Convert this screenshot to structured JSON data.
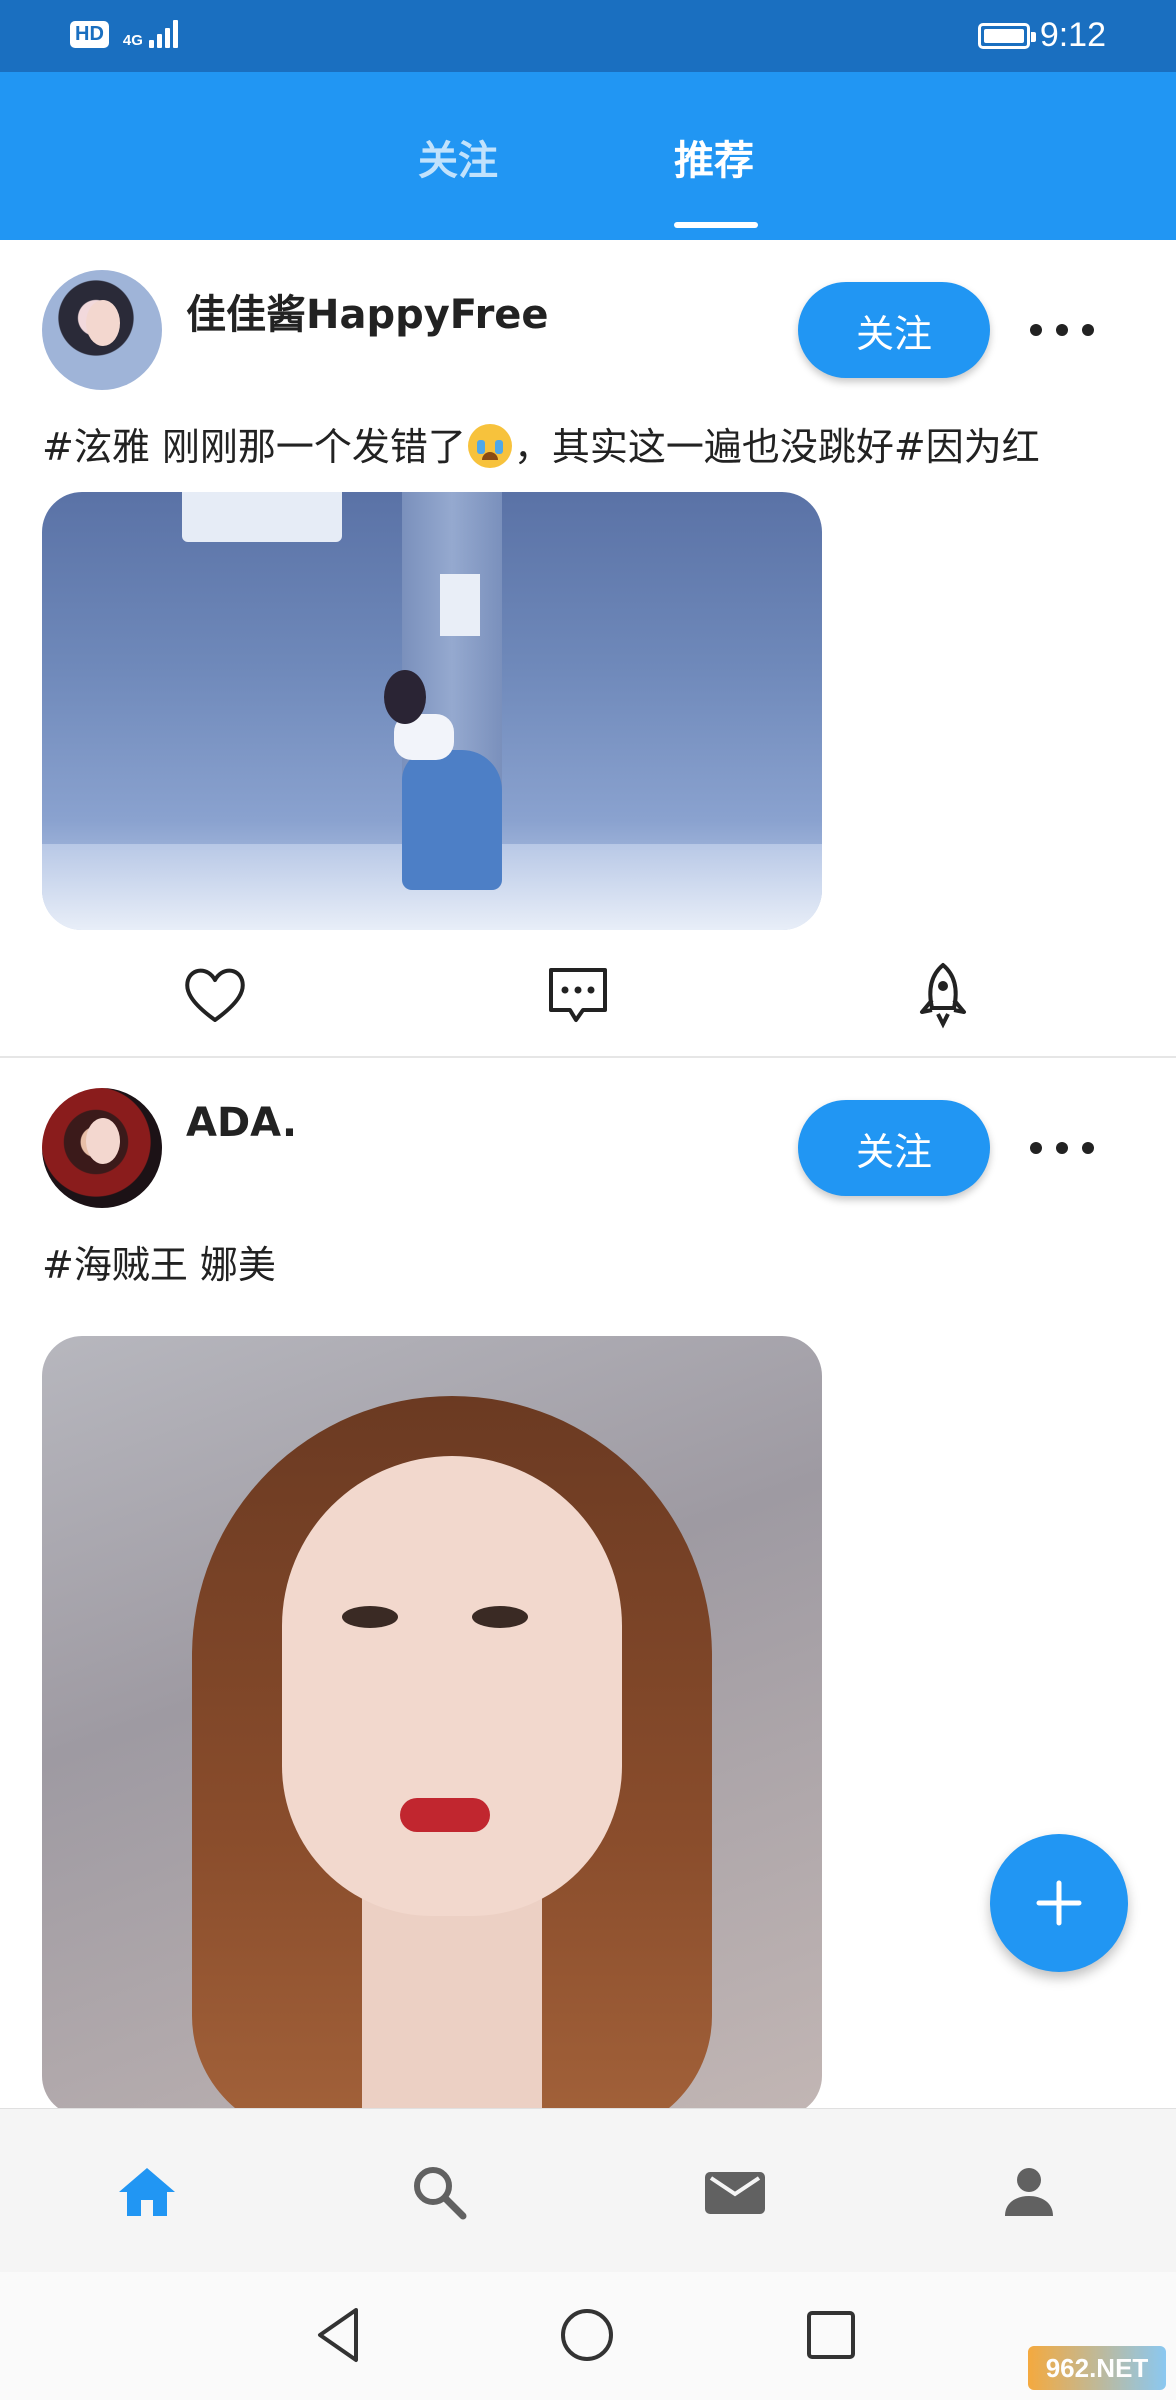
{
  "status_bar": {
    "hd_label": "HD",
    "network_label": "4G",
    "signal_level": 4,
    "battery_level": 1.0,
    "time": "9:12"
  },
  "tabs": [
    {
      "label": "关注",
      "active": false
    },
    {
      "label": "推荐",
      "active": true
    }
  ],
  "posts": [
    {
      "username": "佳佳酱HappyFree",
      "follow_label": "关注",
      "caption_before_emoji": "#泫雅 刚刚那一个发错了",
      "caption_emoji": "loudly-crying-face",
      "caption_after_emoji": "，其实这一遍也没跳好#因为红",
      "media": "video-thumbnail-dancer",
      "actions": [
        "heart-icon",
        "comment-icon",
        "rocket-icon"
      ]
    },
    {
      "username": "ADA.",
      "follow_label": "关注",
      "caption": "#海贼王 娜美",
      "media": "video-thumbnail-portrait"
    }
  ],
  "fab": {
    "icon": "plus-icon"
  },
  "bottom_nav": [
    {
      "icon": "home-icon",
      "active": true
    },
    {
      "icon": "search-icon",
      "active": false
    },
    {
      "icon": "mail-icon",
      "active": false
    },
    {
      "icon": "profile-icon",
      "active": false
    }
  ],
  "system_nav": [
    "back-icon",
    "home-circle-icon",
    "recent-apps-icon"
  ],
  "watermark": "962.NET",
  "colors": {
    "primary": "#2196f3",
    "status_bar": "#1a6fc0",
    "active_nav": "#2196f3",
    "inactive_nav": "#616161"
  }
}
